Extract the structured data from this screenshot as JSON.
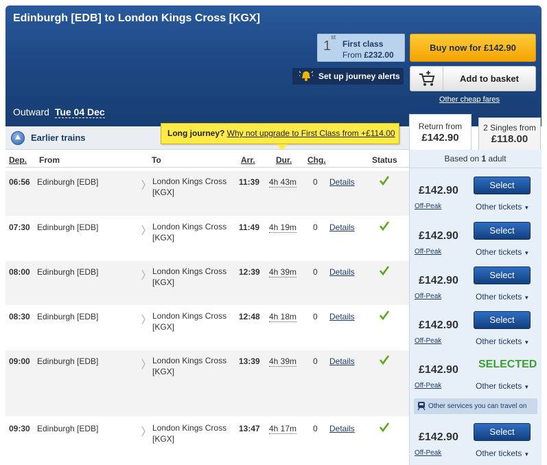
{
  "header": {
    "title": "Edinburgh [EDB] to London Kings Cross [KGX]",
    "first_class": {
      "sup": "st",
      "num": "1",
      "label": "First class",
      "from_label": "From",
      "from_price": "£232.00"
    },
    "buy_now": "Buy now for £142.90",
    "alerts": "Set up journey alerts",
    "add_to_basket": "Add to basket",
    "other_cheap_fares": "Other cheap fares",
    "outward_label": "Outward",
    "outward_date": "Tue 04 Dec"
  },
  "tabs": {
    "return_label": "Return from",
    "return_price": "£142.90",
    "singles_label": "2 Singles from",
    "singles_price": "£118.00"
  },
  "earlier_trains": "Earlier trains",
  "upgrade": {
    "prefix": "Long journey?",
    "link": "Why not upgrade to First Class from +£114.00"
  },
  "based_on": {
    "prefix": "Based on",
    "count": "1",
    "suffix": "adult"
  },
  "columns": {
    "dep": "Dep.",
    "from": "From",
    "to": "To",
    "arr": "Arr.",
    "dur": "Dur.",
    "chg": "Chg.",
    "status": "Status"
  },
  "rows": [
    {
      "dep": "06:56",
      "from": "Edinburgh [EDB]",
      "to1": "London Kings Cross",
      "to2": "[KGX]",
      "arr": "11:39",
      "dur": "4h 43m",
      "chg": "0",
      "details": "Details",
      "price": "£142.90",
      "fare": "Off-Peak",
      "select": "Select",
      "other": "Other tickets"
    },
    {
      "dep": "07:30",
      "from": "Edinburgh [EDB]",
      "to1": "London Kings Cross",
      "to2": "[KGX]",
      "arr": "11:49",
      "dur": "4h 19m",
      "chg": "0",
      "details": "Details",
      "price": "£142.90",
      "fare": "Off-Peak",
      "select": "Select",
      "other": "Other tickets"
    },
    {
      "dep": "08:00",
      "from": "Edinburgh [EDB]",
      "to1": "London Kings Cross",
      "to2": "[KGX]",
      "arr": "12:39",
      "dur": "4h 39m",
      "chg": "0",
      "details": "Details",
      "price": "£142.90",
      "fare": "Off-Peak",
      "select": "Select",
      "other": "Other tickets"
    },
    {
      "dep": "08:30",
      "from": "Edinburgh [EDB]",
      "to1": "London Kings Cross",
      "to2": "[KGX]",
      "arr": "12:48",
      "dur": "4h 18m",
      "chg": "0",
      "details": "Details",
      "price": "£142.90",
      "fare": "Off-Peak",
      "select": "Select",
      "other": "Other tickets"
    },
    {
      "dep": "09:00",
      "from": "Edinburgh [EDB]",
      "to1": "London Kings Cross",
      "to2": "[KGX]",
      "arr": "13:39",
      "dur": "4h 39m",
      "chg": "0",
      "details": "Details",
      "price": "£142.90",
      "fare": "Off-Peak",
      "selected": "SELECTED",
      "other": "Other tickets",
      "other_services": "Other services you can travel on"
    },
    {
      "dep": "09:30",
      "from": "Edinburgh [EDB]",
      "to1": "London Kings Cross",
      "to2": "[KGX]",
      "arr": "13:47",
      "dur": "4h 17m",
      "chg": "0",
      "details": "Details",
      "price": "£142.90",
      "fare": "Off-Peak",
      "select": "Select",
      "other": "Other tickets"
    }
  ],
  "colors": {
    "header": "#1e4a86",
    "buy_now": "#f5a300",
    "select_button": "#1a4f99",
    "selected_text": "#3aa12a",
    "price_panel": "#e7f0f9"
  }
}
